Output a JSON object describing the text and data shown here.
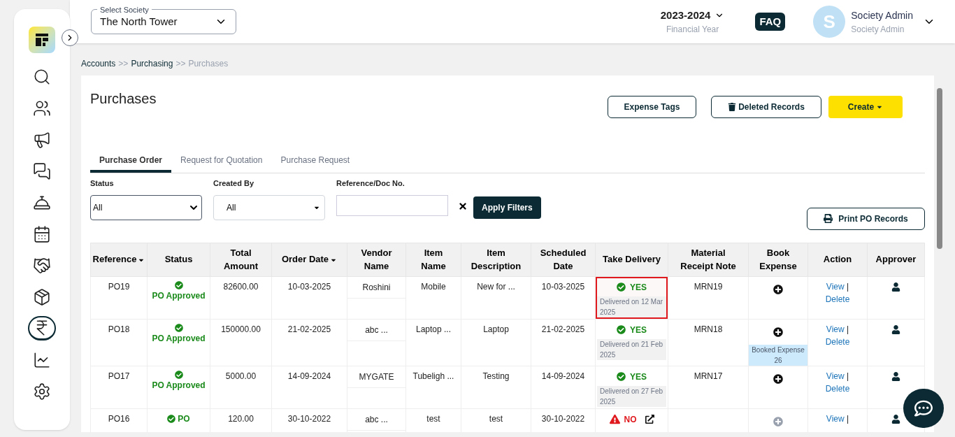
{
  "sidebar": {
    "items": [
      {
        "kind": "search",
        "selected": false
      },
      {
        "kind": "people",
        "selected": false
      },
      {
        "kind": "megaphone",
        "selected": false
      },
      {
        "kind": "chat",
        "selected": false
      },
      {
        "kind": "desk",
        "selected": false
      },
      {
        "kind": "calendar",
        "selected": false
      },
      {
        "kind": "handshake",
        "selected": false
      },
      {
        "kind": "box",
        "selected": false
      },
      {
        "kind": "rupee",
        "selected": true
      },
      {
        "kind": "chart",
        "selected": false
      },
      {
        "kind": "settings",
        "selected": false
      }
    ]
  },
  "header": {
    "society_select": {
      "label": "Select Society",
      "value": "The North Tower"
    },
    "financial_year": {
      "value": "2023-2024",
      "label": "Financial Year"
    },
    "faq": "FAQ",
    "user": {
      "initial": "S",
      "name": "Society Admin",
      "role": "Society Admin"
    }
  },
  "breadcrumb": [
    {
      "label": "Accounts",
      "current": false
    },
    {
      "label": "Purchasing",
      "current": false
    },
    {
      "label": "Purchases",
      "current": true
    }
  ],
  "breadcrumb_separator": ">>",
  "page_title": "Purchases",
  "buttons": {
    "expense_tags": "Expense Tags",
    "deleted_records": "Deleted Records",
    "create": "Create",
    "print": "Print PO Records",
    "apply": "Apply Filters"
  },
  "tabs": [
    {
      "label": "Purchase Order",
      "selected": true
    },
    {
      "label": "Request for Quotation",
      "selected": false
    },
    {
      "label": "Purchase Request",
      "selected": false
    }
  ],
  "filters": [
    {
      "label": "Status",
      "kind": "select",
      "value": "All"
    },
    {
      "label": "Created By",
      "kind": "dropdown",
      "value": "All"
    },
    {
      "label": "Reference/Doc No.",
      "kind": "input"
    }
  ],
  "table": {
    "columns": [
      {
        "label": "Reference",
        "sortable": true
      },
      {
        "label": "Status",
        "sortable": false
      },
      {
        "label": "Total Amount",
        "sortable": false
      },
      {
        "label": "Order Date",
        "sortable": true
      },
      {
        "label": "Vendor Name",
        "sortable": false
      },
      {
        "label": "Item Name",
        "sortable": false
      },
      {
        "label": "Item Description",
        "sortable": false
      },
      {
        "label": "Scheduled Date",
        "sortable": false
      },
      {
        "label": "Take Delivery",
        "sortable": false
      },
      {
        "label": "Material Receipt Note",
        "sortable": false
      },
      {
        "label": "Book Expense",
        "sortable": false
      },
      {
        "label": "Action",
        "sortable": false
      },
      {
        "label": "Approver",
        "sortable": false
      }
    ],
    "action_separator": "|",
    "rows": [
      {
        "reference": "PO19",
        "status": "PO Approved",
        "amount": "82600.00",
        "order_date": "10-03-2025",
        "vendor": "Roshini",
        "item_name": "Mobile",
        "item_description": "New for ...",
        "scheduled_date": "10-03-2025",
        "delivery": {
          "kind": "yes",
          "label": "YES",
          "note": "Delivered on 12 Mar 2025",
          "highlighted": true
        },
        "mrn": "MRN19",
        "book_expense": {
          "enabled": true
        },
        "actions": [
          "View",
          "Delete"
        ]
      },
      {
        "reference": "PO18",
        "status": "PO Approved",
        "amount": "150000.00",
        "order_date": "21-02-2025",
        "vendor": "abc ...",
        "item_name": "Laptop ...",
        "item_description": "Laptop",
        "scheduled_date": "21-02-2025",
        "delivery": {
          "kind": "yes",
          "label": "YES",
          "note": "Delivered on 21 Feb 2025",
          "highlighted": false
        },
        "mrn": "MRN18",
        "book_expense": {
          "enabled": true,
          "booked": "Booked Expense 26"
        },
        "actions": [
          "View",
          "Delete"
        ]
      },
      {
        "reference": "PO17",
        "status": "PO Approved",
        "amount": "5000.00",
        "order_date": "14-09-2024",
        "vendor": "MYGATE",
        "item_name": "Tubeligh ...",
        "item_description": "Testing",
        "scheduled_date": "14-09-2024",
        "delivery": {
          "kind": "yes",
          "label": "YES",
          "note": "Delivered on 27 Feb 2025",
          "highlighted": false
        },
        "mrn": "MRN17",
        "book_expense": {
          "enabled": true
        },
        "actions": [
          "View",
          "Delete"
        ]
      },
      {
        "reference": "PO16",
        "status": "PO",
        "amount": "120.00",
        "order_date": "30-10-2022",
        "vendor": "abc ...",
        "item_name": "test",
        "item_description": "test",
        "scheduled_date": "30-10-2022",
        "delivery": {
          "kind": "no",
          "label": "NO",
          "highlighted": false
        },
        "book_expense": {
          "enabled": false
        },
        "actions": [
          "View"
        ]
      }
    ]
  }
}
